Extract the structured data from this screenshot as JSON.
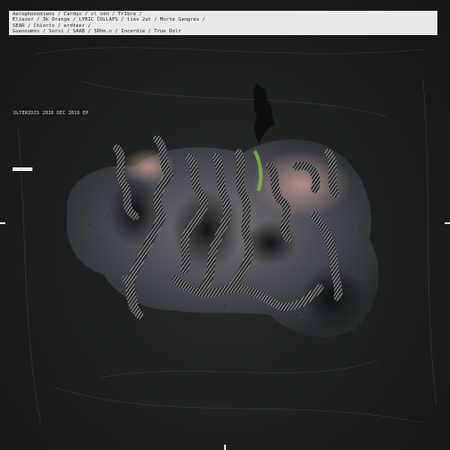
{
  "header": {
    "lines": [
      "Aerophonodiens / Cardus / cl_oen / Tr1bre /",
      "Eliazer / 3k Orange / LYRIC COLLAPS / ties 2ut / Morte Sangres /",
      "SEAR / Chiorto / erdteer /",
      "Guennumns / Sorvi / SAAB / SDhm.n / Incerdie / True Dolr"
    ]
  },
  "label": {
    "text": "ULTERIDIS 2016 DEC 2016 EP"
  },
  "colors": {
    "background": "#1b1d1c",
    "banner": "#e9e9e9",
    "mark": "#e6e6e6"
  }
}
